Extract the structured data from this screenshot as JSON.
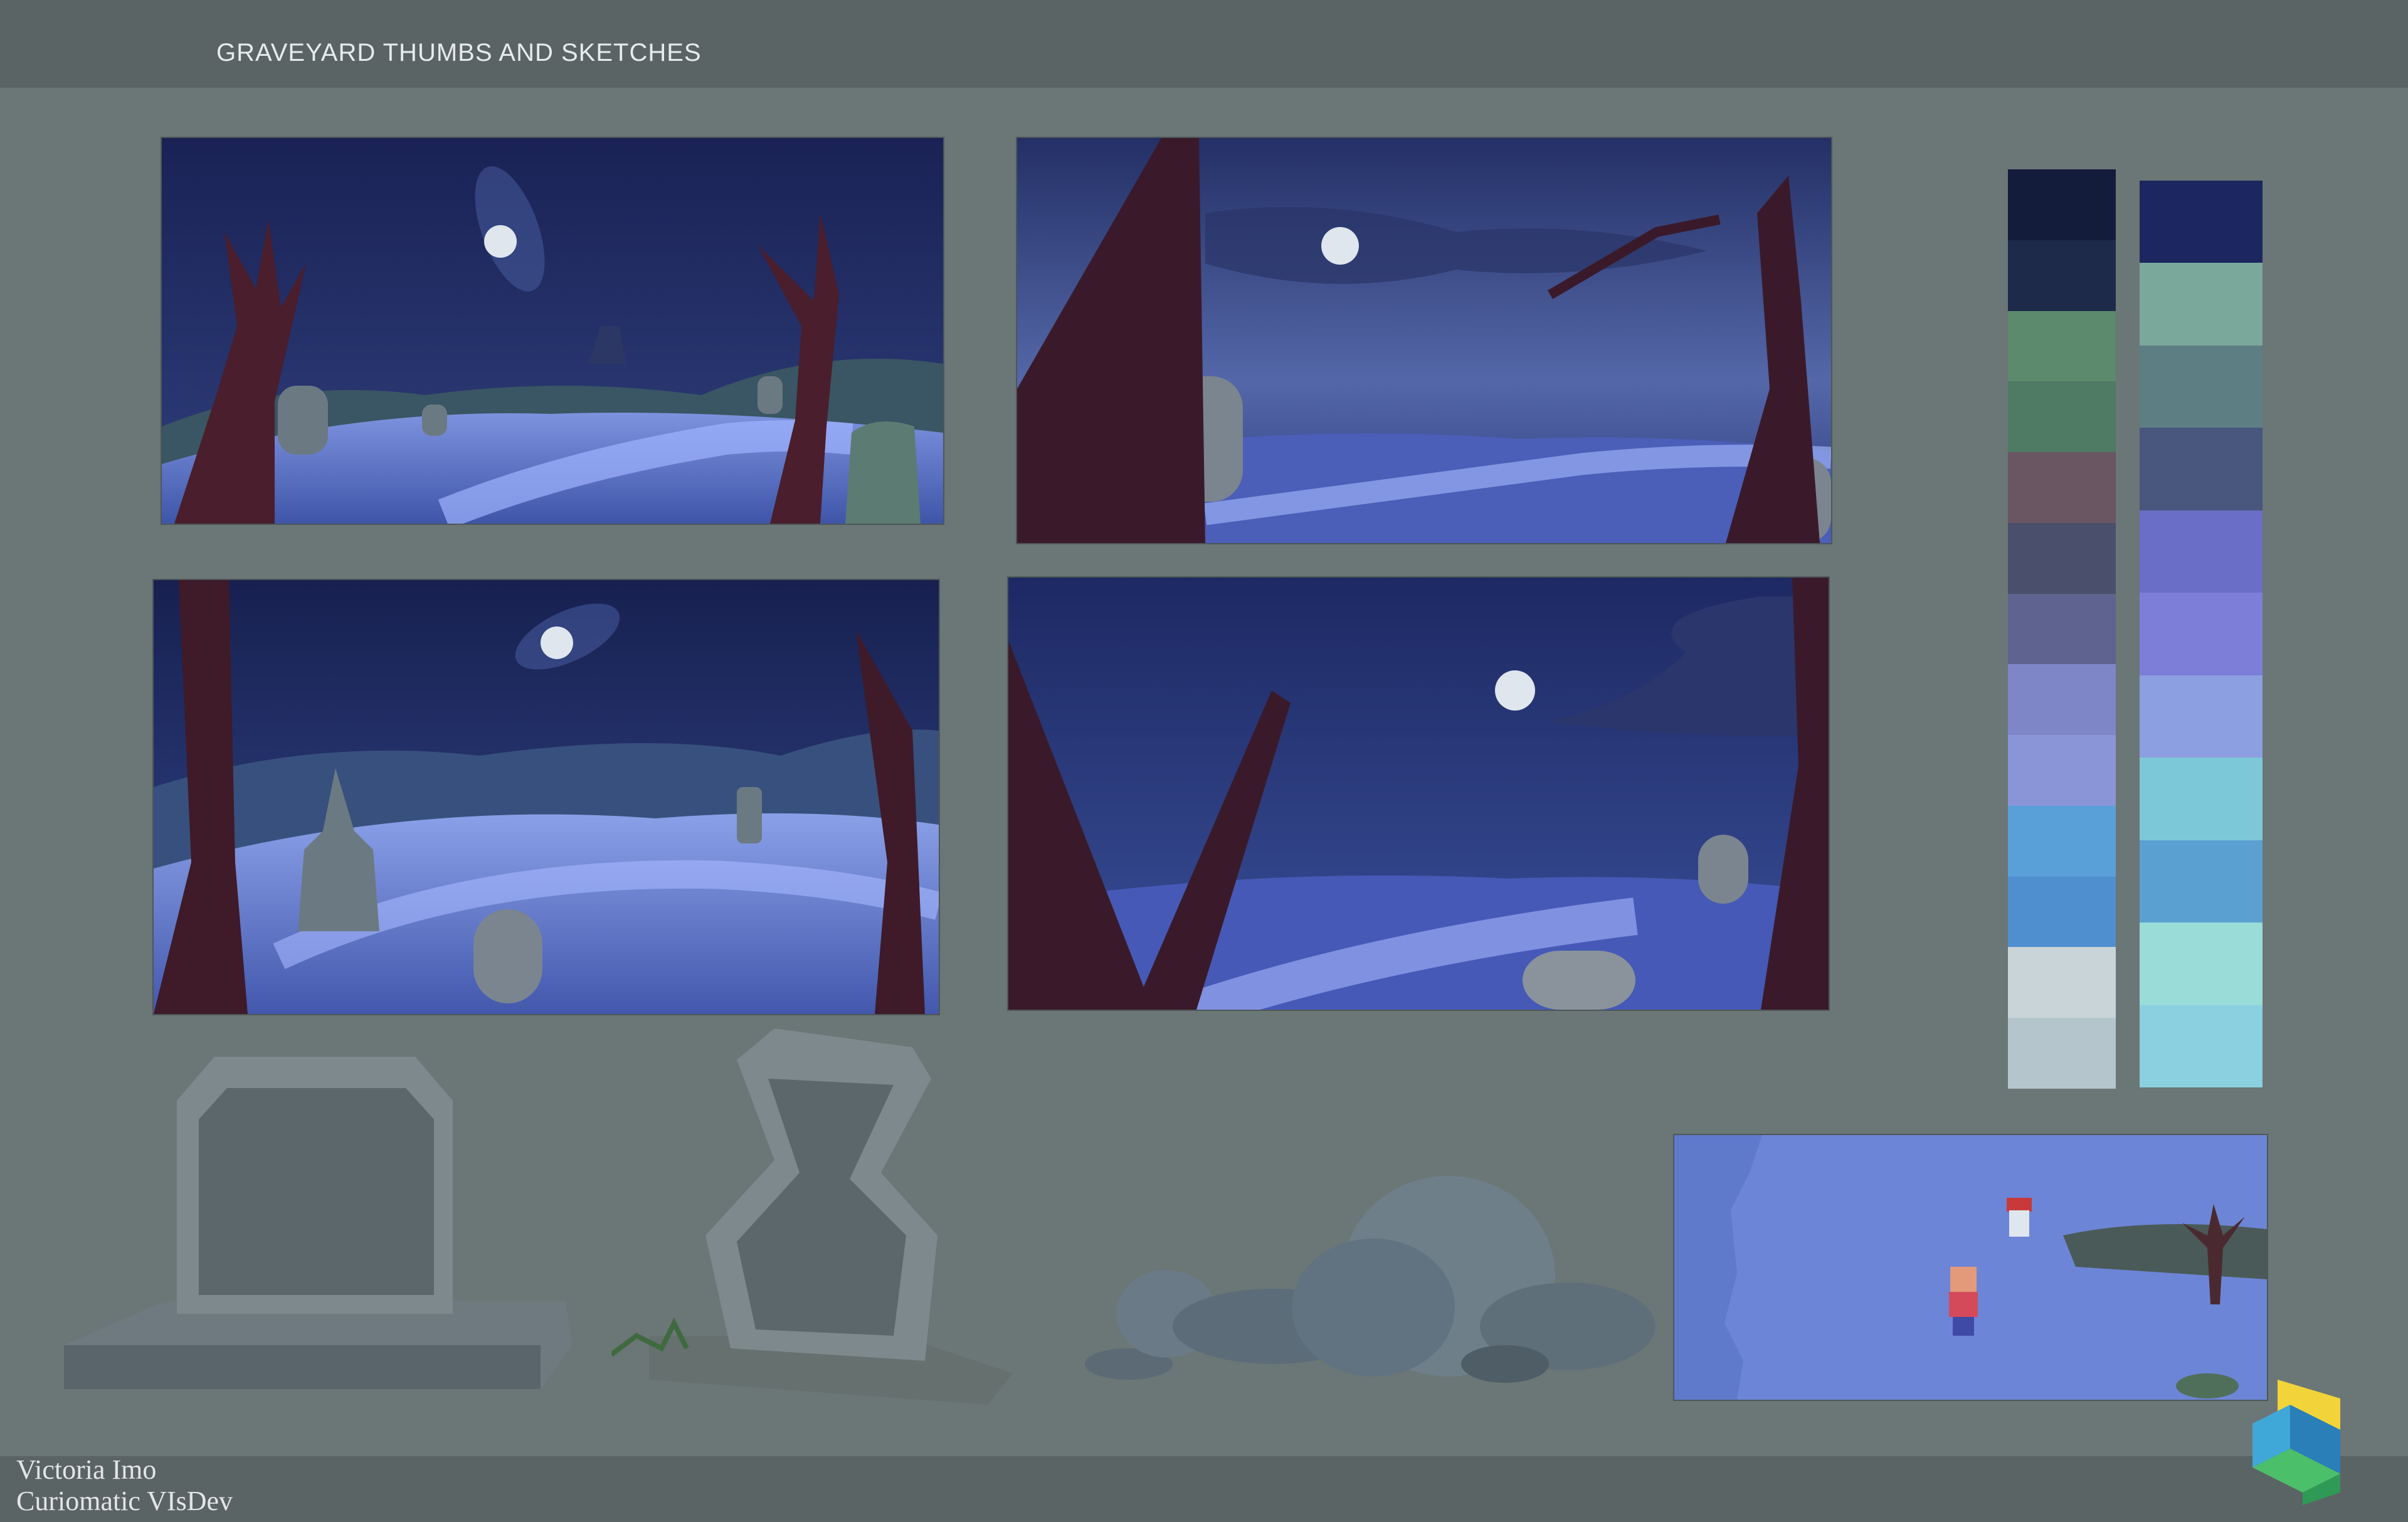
{
  "header": {
    "title": "GRAVEYARD THUMBS AND SKETCHES"
  },
  "footer": {
    "artist": "Victoria Imo",
    "studio": "Curiomatic VIsDev"
  },
  "palette_warm": [
    "#141c3c",
    "#1e2a4a",
    "#5b8a6c",
    "#4f7a63",
    "#6a5563",
    "#4a4f6b",
    "#5e6390",
    "#7e86c8",
    "#8a95d8",
    "#5aa0d8",
    "#4f8fd0",
    "#c8d4d8",
    "#b4c6cc"
  ],
  "palette_glitch": [
    "#1c2660",
    "#7aa89a",
    "#5d7f84",
    "#49567e",
    "#6a6ec6",
    "#7c7ed8",
    "#8c9fe0",
    "#7cc8d8",
    "#5aa0d0",
    "#9adcd8",
    "#8ad0e0"
  ],
  "colors": {
    "background": "#6b7676",
    "bar": "#5b6464",
    "night": "#1f2a5c",
    "moon": "#dfe6ee",
    "snow": "#6d85d6",
    "tree": "#4a1e2c",
    "stone": "#6b7a82"
  },
  "icons": [
    "studio-logo-icon"
  ]
}
